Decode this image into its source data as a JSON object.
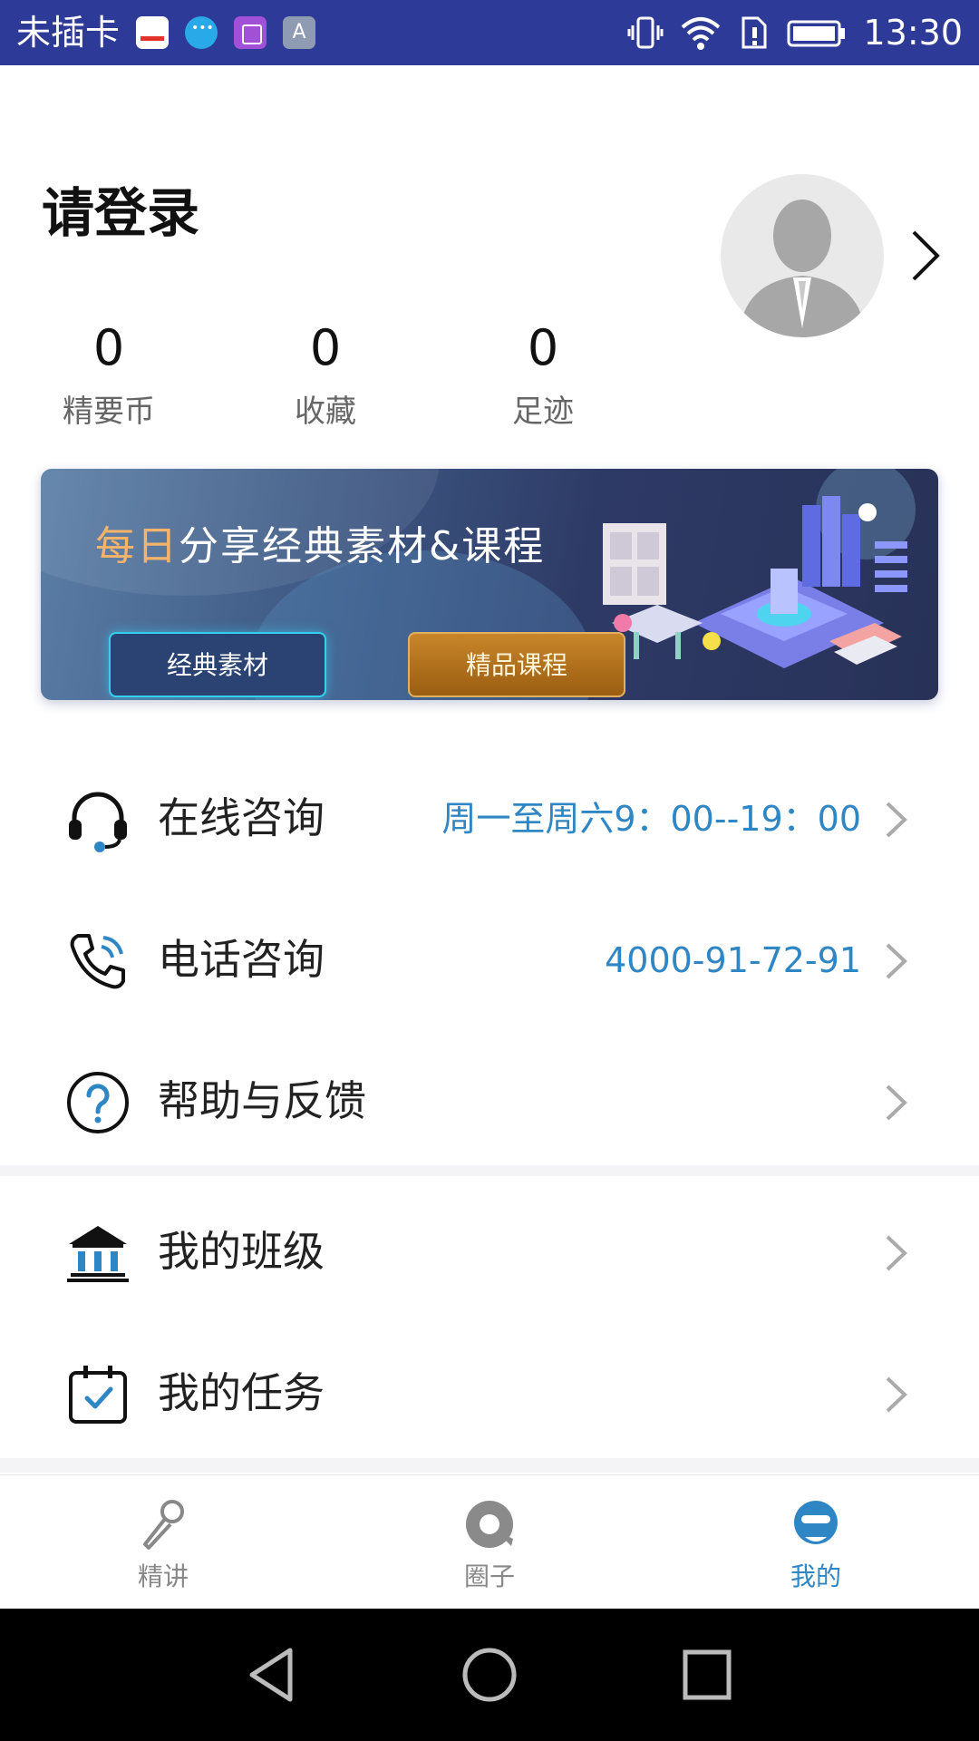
{
  "status_bar": {
    "carrier": "未插卡",
    "time": "13:30",
    "app_icons": [
      "youku-icon",
      "message-bubble-icon",
      "gallery-icon",
      "font-icon"
    ],
    "system_icons": [
      "vibrate-icon",
      "wifi-icon",
      "sim-alert-icon",
      "battery-icon"
    ]
  },
  "profile": {
    "login_prompt": "请登录",
    "stats": [
      {
        "value": "0",
        "label": "精要币"
      },
      {
        "value": "0",
        "label": "收藏"
      },
      {
        "value": "0",
        "label": "足迹"
      }
    ]
  },
  "banner": {
    "headline_highlight": "每日",
    "headline_rest": "分享经典素材&课程",
    "buttons": [
      {
        "label": "经典素材"
      },
      {
        "label": "精品课程"
      }
    ]
  },
  "menu": [
    {
      "icon": "headset-icon",
      "label": "在线咨询",
      "value": "周一至周六9：00--19：00"
    },
    {
      "icon": "phone-icon",
      "label": "电话咨询",
      "value": "4000-91-72-91"
    },
    {
      "icon": "help-icon",
      "label": "帮助与反馈",
      "value": ""
    },
    {
      "icon": "class-building-icon",
      "label": "我的班级",
      "value": ""
    },
    {
      "icon": "calendar-check-icon",
      "label": "我的任务",
      "value": ""
    }
  ],
  "tabs": [
    {
      "icon": "microphone-icon",
      "label": "精讲",
      "active": false
    },
    {
      "icon": "circle-search-icon",
      "label": "圈子",
      "active": false
    },
    {
      "icon": "profile-face-icon",
      "label": "我的",
      "active": true
    }
  ],
  "colors": {
    "status_bar": "#2e3a97",
    "accent": "#2f86c5",
    "banner_highlight": "#f6b36a"
  }
}
